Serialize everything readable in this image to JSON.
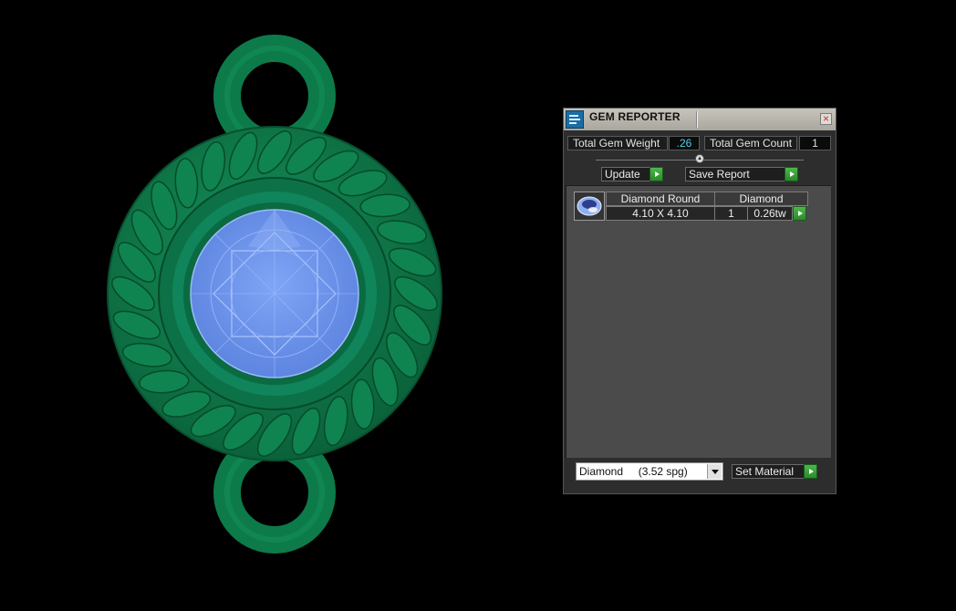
{
  "window": {
    "title": "GEM REPORTER",
    "close_icon": "close-icon",
    "app_icon": "gem-reporter-icon"
  },
  "summary": {
    "weight_label": "Total Gem Weight",
    "weight_value": ".26",
    "count_label": "Total Gem Count",
    "count_value": "1"
  },
  "actions": {
    "update_label": "Update",
    "save_label": "Save Report"
  },
  "report": {
    "headers": [
      "Diamond Round",
      "Diamond"
    ],
    "rows": [
      {
        "size": "4.10 X 4.10",
        "count": "1",
        "weight": "0.26tw"
      }
    ]
  },
  "material": {
    "selected": "Diamond     (3.52 spg)",
    "set_label": "Set Material"
  },
  "colors": {
    "metal": "#0e7a4a",
    "gem": "#6f97ee",
    "panel": "#2d2d2d",
    "accent_green": "#3aa63a",
    "value_cyan": "#4fd2e8"
  }
}
